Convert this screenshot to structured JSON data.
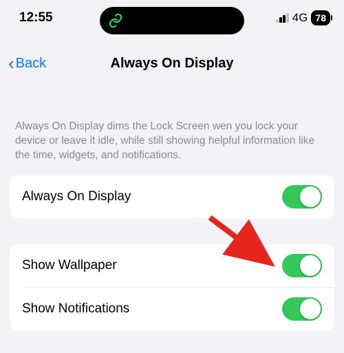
{
  "status": {
    "time": "12:55",
    "network": "4G",
    "battery": "78"
  },
  "nav": {
    "back": "Back",
    "title": "Always On Display"
  },
  "description": "Always On Display dims the Lock Screen wen you lock your device or leave it idle, while still showing helpful information like the time, widgets, and notifications.",
  "rows": {
    "main": "Always On Display",
    "wallpaper": "Show Wallpaper",
    "notifications": "Show Notifications"
  },
  "toggles": {
    "main": true,
    "wallpaper": true,
    "notifications": true
  }
}
